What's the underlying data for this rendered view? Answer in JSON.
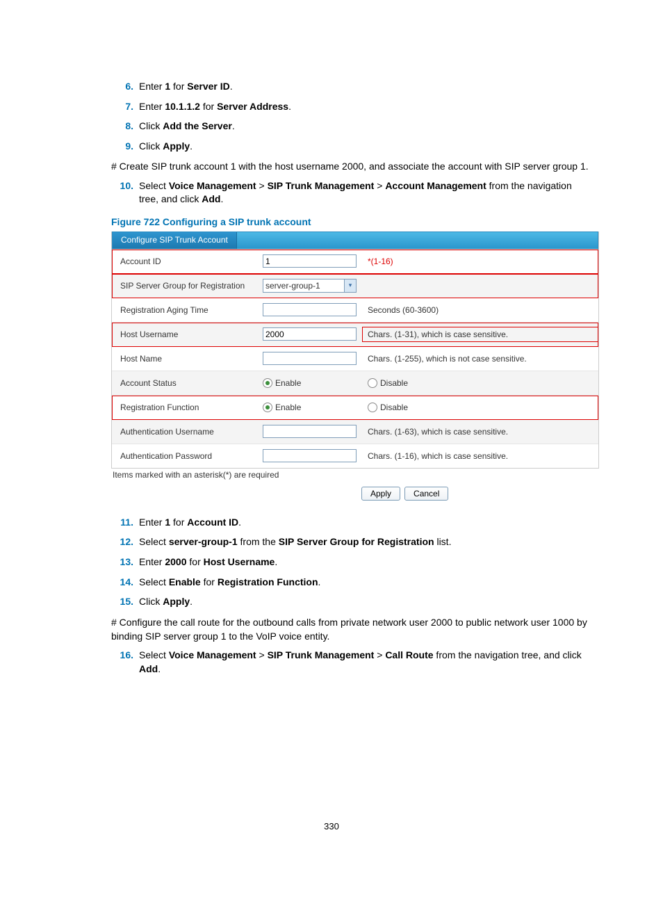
{
  "steps_a": [
    {
      "n": "6.",
      "pre": "Enter ",
      "b1": "1",
      "mid": " for ",
      "b2": "Server ID",
      "post": "."
    },
    {
      "n": "7.",
      "pre": "Enter ",
      "b1": "10.1.1.2",
      "mid": " for ",
      "b2": "Server Address",
      "post": "."
    },
    {
      "n": "8.",
      "pre": "Click ",
      "b1": "Add the Server",
      "mid": "",
      "b2": "",
      "post": "."
    },
    {
      "n": "9.",
      "pre": "Click ",
      "b1": "Apply",
      "mid": "",
      "b2": "",
      "post": "."
    }
  ],
  "para1": "# Create SIP trunk account 1 with the host username 2000, and associate the account with SIP server group 1.",
  "step10_n": "10.",
  "step10_t1": "Select ",
  "step10_b1": "Voice Management",
  "step10_s1": " > ",
  "step10_b2": "SIP Trunk Management",
  "step10_s2": " > ",
  "step10_b3": "Account Management",
  "step10_t2": " from the navigation tree, and click ",
  "step10_b4": "Add",
  "step10_t3": ".",
  "fig_caption": "Figure 722 Configuring a SIP trunk account",
  "form": {
    "header_tab": "Configure SIP Trunk Account",
    "rows": {
      "account_id_label": "Account ID",
      "account_id_value": "1",
      "account_id_hint": "(1-16)",
      "sip_group_label": "SIP Server Group for Registration",
      "sip_group_value": "server-group-1",
      "reg_aging_label": "Registration Aging Time",
      "reg_aging_value": "",
      "reg_aging_hint": "Seconds (60-3600)",
      "host_user_label": "Host Username",
      "host_user_value": "2000",
      "host_user_hint": "Chars. (1-31), which is case sensitive.",
      "host_name_label": "Host Name",
      "host_name_value": "",
      "host_name_hint": "Chars. (1-255), which is not case sensitive.",
      "acct_status_label": "Account Status",
      "enable_label": "Enable",
      "disable_label": "Disable",
      "reg_func_label": "Registration Function",
      "auth_user_label": "Authentication Username",
      "auth_user_hint": "Chars. (1-63), which is case sensitive.",
      "auth_pass_label": "Authentication Password",
      "auth_pass_hint": "Chars. (1-16), which is case sensitive."
    },
    "note": "Items marked with an asterisk(*) are required",
    "apply_btn": "Apply",
    "cancel_btn": "Cancel",
    "req_prefix": "*"
  },
  "steps_b": [
    {
      "n": "11.",
      "pre": "Enter ",
      "b1": "1",
      "mid": " for ",
      "b2": "Account ID",
      "post": "."
    },
    {
      "n": "12.",
      "pre": "Select ",
      "b1": "server-group-1",
      "mid": " from the ",
      "b2": "SIP Server Group for Registration",
      "post": " list."
    },
    {
      "n": "13.",
      "pre": "Enter ",
      "b1": "2000",
      "mid": " for ",
      "b2": "Host Username",
      "post": "."
    },
    {
      "n": "14.",
      "pre": "Select ",
      "b1": "Enable",
      "mid": " for ",
      "b2": "Registration Function",
      "post": "."
    },
    {
      "n": "15.",
      "pre": "Click ",
      "b1": "Apply",
      "mid": "",
      "b2": "",
      "post": "."
    }
  ],
  "para2": "# Configure the call route for the outbound calls from private network user 2000 to public network user 1000 by binding SIP server group 1 to the VoIP voice entity.",
  "step16_n": "16.",
  "step16_t1": "Select ",
  "step16_b1": "Voice Management",
  "step16_s1": " > ",
  "step16_b2": "SIP Trunk Management",
  "step16_s2": " > ",
  "step16_b3": "Call Route",
  "step16_t2": " from the navigation tree, and click ",
  "step16_b4": "Add",
  "step16_t3": ".",
  "page_number": "330"
}
